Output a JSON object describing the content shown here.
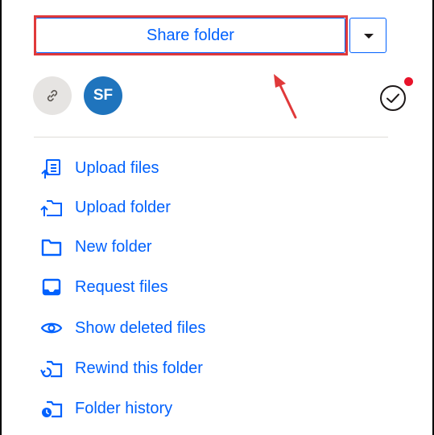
{
  "share": {
    "label": "Share folder"
  },
  "people": {
    "avatar_initials": "SF",
    "link_icon": "link-icon",
    "activity_icon": "check-circle-icon"
  },
  "actions": [
    {
      "label": "Upload files",
      "icon": "upload-files-icon"
    },
    {
      "label": "Upload folder",
      "icon": "upload-folder-icon"
    },
    {
      "label": "New folder",
      "icon": "folder-icon"
    },
    {
      "label": "Request files",
      "icon": "request-files-icon"
    },
    {
      "label": "Show deleted files",
      "icon": "eye-icon"
    },
    {
      "label": "Rewind this folder",
      "icon": "rewind-folder-icon"
    },
    {
      "label": "Folder history",
      "icon": "folder-history-icon"
    }
  ],
  "colors": {
    "accent": "#0061fe",
    "avatar": "#1f74bd",
    "highlight": "#e0393a",
    "notification": "#e8132a"
  }
}
